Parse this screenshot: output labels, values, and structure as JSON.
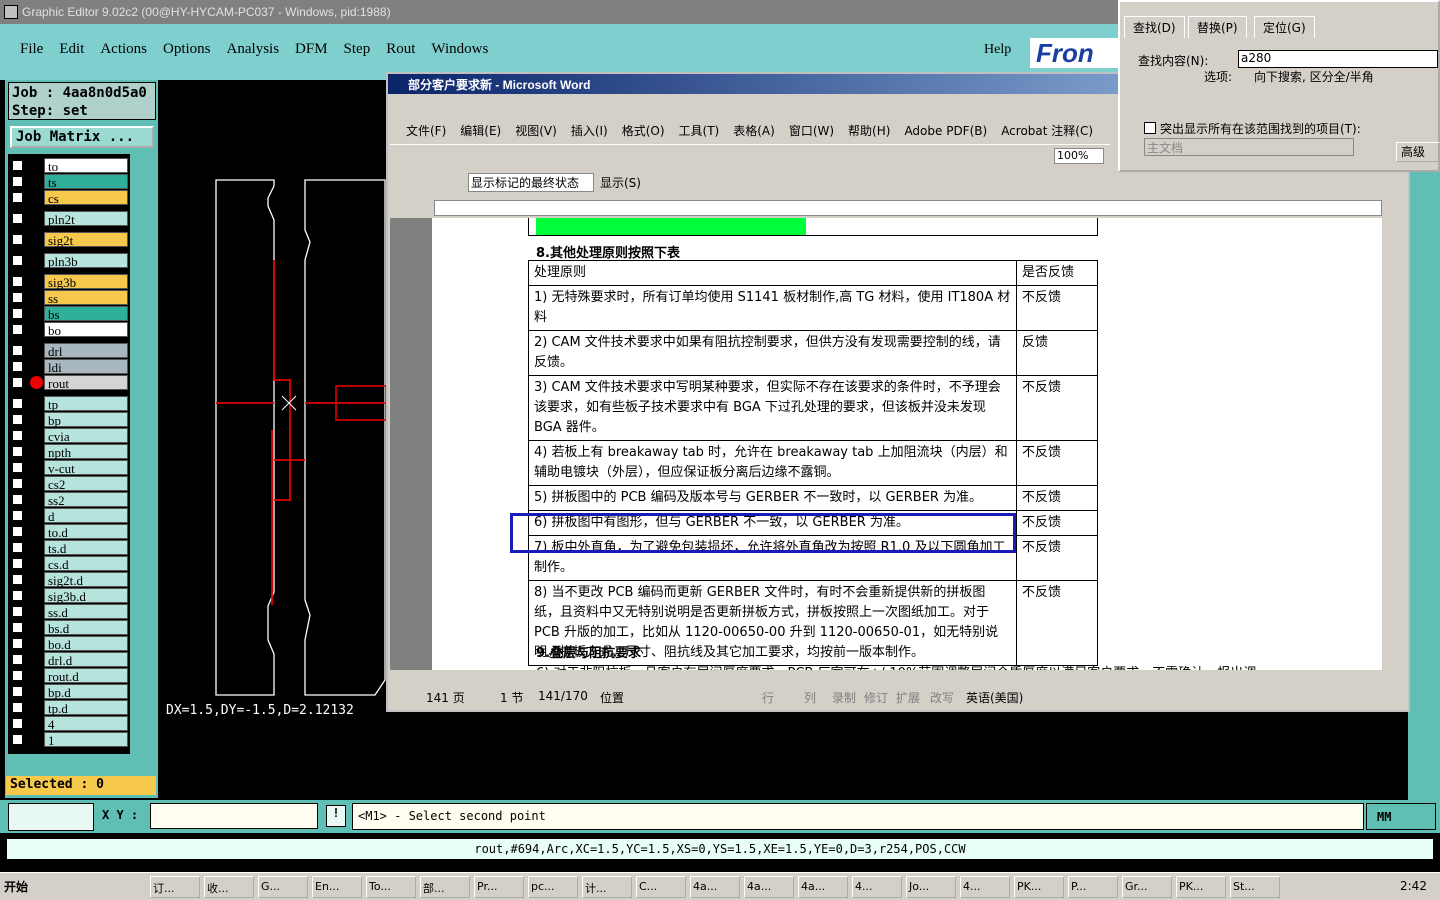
{
  "ge": {
    "title": "Graphic Editor 9.02c2 (00@HY-HYCAM-PC037 - Windows, pid:1988)",
    "menu": [
      "File",
      "Edit",
      "Actions",
      "Options",
      "Analysis",
      "DFM",
      "Step",
      "Rout",
      "Windows"
    ],
    "help": "Help",
    "logo": "Fron",
    "job": "Job : 4aa8n0d5a0",
    "step": "Step: set",
    "job_matrix": "Job Matrix ...",
    "layers": [
      {
        "n": "to",
        "c": "#ffffff"
      },
      {
        "n": "ts",
        "c": "#2fb09a"
      },
      {
        "n": "cs",
        "c": "#f6c84c"
      },
      {
        "n": "pln2t",
        "c": "#b6e3dc"
      },
      {
        "n": "sig2t",
        "c": "#f6c84c"
      },
      {
        "n": "pln3b",
        "c": "#b6e3dc"
      },
      {
        "n": "sig3b",
        "c": "#f6c84c"
      },
      {
        "n": "ss",
        "c": "#f6c84c"
      },
      {
        "n": "bs",
        "c": "#2fb09a"
      },
      {
        "n": "bo",
        "c": "#ffffff"
      },
      {
        "n": "drl",
        "c": "#a9b7c0"
      },
      {
        "n": "ldi",
        "c": "#a9b7c0"
      },
      {
        "n": "rout",
        "c": "#d4d4d4"
      },
      {
        "n": "tp",
        "c": "#b6e3dc"
      },
      {
        "n": "bp",
        "c": "#b6e3dc"
      },
      {
        "n": "cvia",
        "c": "#b6e3dc"
      },
      {
        "n": "npth",
        "c": "#b6e3dc"
      },
      {
        "n": "v-cut",
        "c": "#b6e3dc"
      },
      {
        "n": "cs2",
        "c": "#b6e3dc"
      },
      {
        "n": "ss2",
        "c": "#b6e3dc"
      },
      {
        "n": "d",
        "c": "#b6e3dc"
      },
      {
        "n": "to.d",
        "c": "#b6e3dc"
      },
      {
        "n": "ts.d",
        "c": "#b6e3dc"
      },
      {
        "n": "cs.d",
        "c": "#b6e3dc"
      },
      {
        "n": "sig2t.d",
        "c": "#b6e3dc"
      },
      {
        "n": "sig3b.d",
        "c": "#b6e3dc"
      },
      {
        "n": "ss.d",
        "c": "#b6e3dc"
      },
      {
        "n": "bs.d",
        "c": "#b6e3dc"
      },
      {
        "n": "bo.d",
        "c": "#b6e3dc"
      },
      {
        "n": "drl.d",
        "c": "#b6e3dc"
      },
      {
        "n": "rout.d",
        "c": "#b6e3dc"
      },
      {
        "n": "bp.d",
        "c": "#b6e3dc"
      },
      {
        "n": "tp.d",
        "c": "#b6e3dc"
      },
      {
        "n": "4",
        "c": "#b6e3dc"
      },
      {
        "n": "1",
        "c": "#b6e3dc"
      }
    ],
    "selected": "Selected : 0",
    "dx": "DX=1.5,DY=-1.5,D=2.12132",
    "xy_label": "X Y :",
    "prompt": "<M1> - Select second point",
    "units": "MM",
    "status": "rout,#694,Arc,XC=1.5,YC=1.5,XS=0,YS=1.5,XE=1.5,YE=0,D=3,r254,POS,CCW"
  },
  "word": {
    "title": "部分客户要求新 - Microsoft Word",
    "menu": [
      "文件(F)",
      "编辑(E)",
      "视图(V)",
      "插入(I)",
      "格式(O)",
      "工具(T)",
      "表格(A)",
      "窗口(W)",
      "帮助(H)",
      "Adobe PDF(B)",
      "Acrobat 注释(C)"
    ],
    "zoom": "100%",
    "markup": "显示标记的最终状态",
    "show": "显示(S)",
    "heading8": "8.其他处理原则按照下表",
    "col1": "处理原则",
    "col2": "是否反馈",
    "rows": [
      {
        "a": "1) 无特殊要求时，所有订单均使用 S1141 板材制作,高 TG 材料，使用 IT180A 材料",
        "b": "不反馈"
      },
      {
        "a": "2) CAM 文件技术要求中如果有阻抗控制要求，但供方没有发现需要控制的线，请反馈。",
        "b": "反馈"
      },
      {
        "a": "3) CAM 文件技术要求中写明某种要求，但实际不存在该要求的条件时，不予理会该要求，如有些板子技术要求中有 BGA 下过孔处理的要求，但该板并没未发现 BGA 器件。",
        "b": "不反馈"
      },
      {
        "a": "4) 若板上有 breakaway tab 时，允许在 breakaway tab 上加阻流块（内层）和辅助电镀块（外层），但应保证板分离后边缘不露铜。",
        "b": "不反馈"
      },
      {
        "a": "5) 拼板图中的 PCB 编码及版本号与 GERBER 不一致时，以 GERBER 为准。",
        "b": "不反馈"
      },
      {
        "a": "6) 拼板图中有图形，但与 GERBER 不一致，以 GERBER 为准。",
        "b": "不反馈"
      },
      {
        "a": "7) 板中外直角，为了避免包装损坏，允许将外直角改为按照 R1.0 及以下圆角加工制作。",
        "b": "不反馈"
      },
      {
        "a": "8) 当不更改 PCB 编码而更新 GERBER 文件时，有时不会重新提供新的拼板图纸，且资料中又无特别说明是否更新拼板方式，拼板按照上一次图纸加工。对于 PCB 升版的加工，比如从 1120-00650-00 升到 1120-00650-01，如无特别说明，拼板方式、尺寸、阻抗线及其它加工要求，均按前一版本制作。",
        "b": "不反馈"
      }
    ],
    "heading9": "9.叠层与阻抗要求",
    "cut_line": "6) 对于非阻抗板，且客户有层间厚度要求，PCB 厂家可在+/-10%范围调整层间介质厚度以满足客户要求，不需确认，报出调",
    "status": {
      "page": "141 页",
      "sec": "1 节",
      "pos": "141/170",
      "loc": "位置",
      "row": "行",
      "col": "列",
      "rec": "录制",
      "rev": "修订",
      "ext": "扩展",
      "ovr": "改写",
      "lang": "英语(美国)"
    }
  },
  "find": {
    "tabs": [
      "查找(D)",
      "替换(P)",
      "定位(G)"
    ],
    "label": "查找内容(N):",
    "value": "a280",
    "opt_label": "选项:",
    "opt": "向下搜索, 区分全/半角",
    "chk": "突出显示所有在该范围找到的项目(T):",
    "combo": "主文档",
    "adv": "高级"
  },
  "taskbar": {
    "start": "开始",
    "items": [
      "订...",
      "收...",
      "G...",
      "En...",
      "To...",
      "部...",
      "Pr...",
      "pc...",
      "计...",
      "C...",
      "4a...",
      "4a...",
      "4a...",
      "4...",
      "Jo...",
      "4...",
      "PK...",
      "P...",
      "Gr...",
      "PK...",
      "St..."
    ],
    "time": "2:42"
  }
}
